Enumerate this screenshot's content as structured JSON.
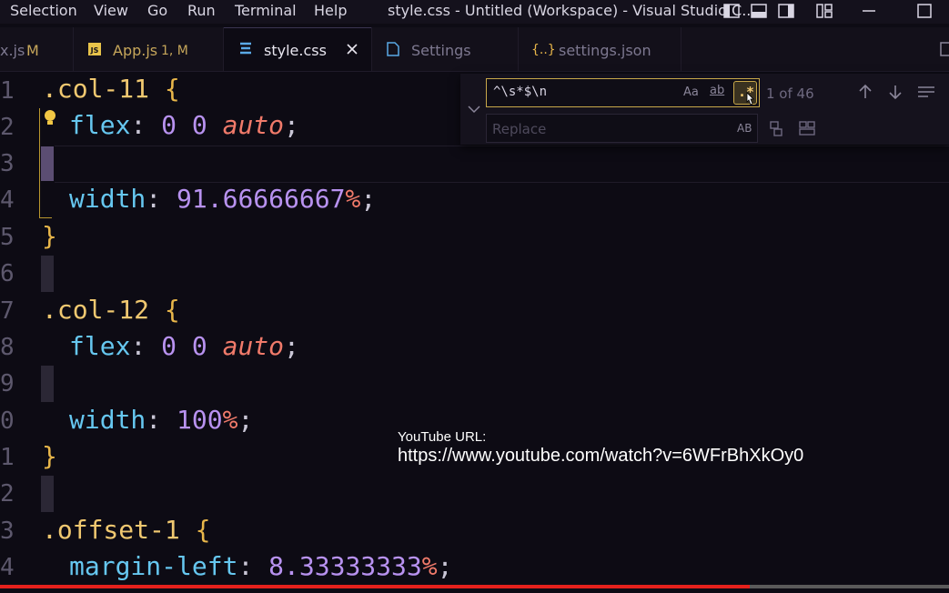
{
  "menubar": {
    "items": [
      "Selection",
      "View",
      "Go",
      "Run",
      "Terminal",
      "Help"
    ],
    "window_title": "style.css - Untitled (Workspace) - Visual Studio C..."
  },
  "tabs": [
    {
      "label": "x.js",
      "badge": "M",
      "icon": "js-file-icon"
    },
    {
      "label": "App.js",
      "badge": "1, M",
      "icon": "js-file-icon"
    },
    {
      "label": "style.css",
      "badge": "",
      "icon": "css-file-icon",
      "active": true
    },
    {
      "label": "Settings",
      "badge": "",
      "icon": "file-icon"
    },
    {
      "label": "settings.json",
      "badge": "",
      "icon": "json-braces-icon"
    }
  ],
  "editor": {
    "line_numbers": [
      "1",
      "2",
      "3",
      "4",
      "5",
      "6",
      "7",
      "8",
      "9",
      "0",
      "1",
      "2",
      "3",
      "4"
    ],
    "lines": [
      ".col-11 {",
      "  flex: 0 0 auto;",
      "",
      "  width: 91.66666667%;",
      "}",
      "",
      ".col-12 {",
      "  flex: 0 0 auto;",
      "",
      "  width: 100%;",
      "}",
      "",
      ".offset-1 {",
      "  margin-left: 8.33333333%;"
    ],
    "tokens": {
      "col11": ".col-11",
      "col12": ".col-12",
      "offset1": ".offset-1",
      "open": "{",
      "close": "}",
      "flex": "flex",
      "width": "width",
      "margin_left": "margin-left",
      "colon": ":",
      "semi": ";",
      "zero": "0",
      "auto": "auto",
      "w1": "91.66666667",
      "w2": "100",
      "ml": "8.33333333",
      "pct": "%"
    }
  },
  "find_widget": {
    "search_value": "^\\s*$\\n",
    "replace_placeholder": "Replace",
    "match_case_label": "Aa",
    "whole_word_label": "ab",
    "regex_label": ".*",
    "preserve_case_label": "AB",
    "result_count": "1 of 46"
  },
  "overlay": {
    "label": "YouTube URL:",
    "url": "https://www.youtube.com/watch?v=6WFrBhXkOy0",
    "progress": 0.79
  },
  "colors": {
    "accent": "#c8a84a",
    "progress": "#e5211c",
    "selector": "#f0c870",
    "property": "#66c7f0",
    "number": "#b892f0",
    "keyword": "#f07a6a"
  }
}
